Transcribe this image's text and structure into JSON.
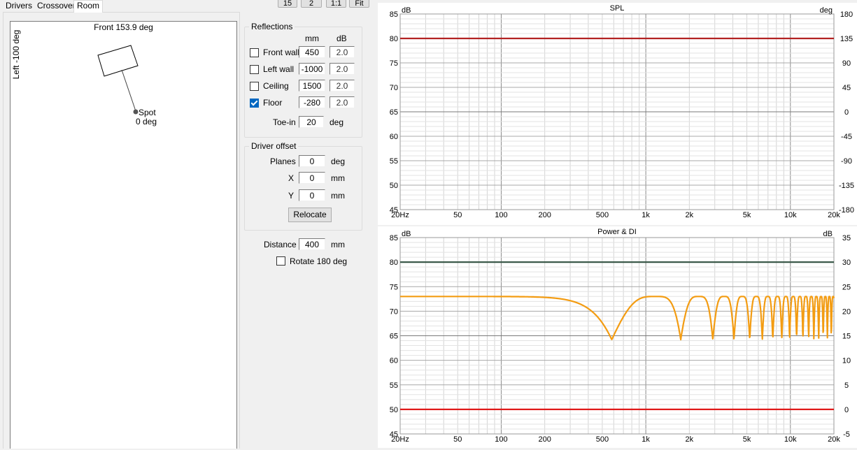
{
  "tabs": [
    "Drivers",
    "Crossover",
    "Room"
  ],
  "toolbar": [
    "15",
    "2",
    "1:1",
    "Fit"
  ],
  "room": {
    "front_label": "Front 153.9 deg",
    "left_label": "Left -100 deg",
    "spot_label": "Spot",
    "spot_deg": "0 deg"
  },
  "reflections": {
    "title": "Reflections",
    "col_mm": "mm",
    "col_db": "dB",
    "rows": [
      {
        "label": "Front wall",
        "checked": false,
        "mm": "450",
        "db": "2.0"
      },
      {
        "label": "Left wall",
        "checked": false,
        "mm": "-1000",
        "db": "2.0"
      },
      {
        "label": "Ceiling",
        "checked": false,
        "mm": "1500",
        "db": "2.0"
      },
      {
        "label": "Floor",
        "checked": true,
        "mm": "-280",
        "db": "2.0"
      }
    ],
    "toein_label": "Toe-in",
    "toein_value": "20",
    "toein_unit": "deg"
  },
  "offset": {
    "title": "Driver offset",
    "planes_label": "Planes",
    "planes_value": "0",
    "planes_unit": "deg",
    "x_label": "X",
    "x_value": "0",
    "x_unit": "mm",
    "y_label": "Y",
    "y_value": "0",
    "y_unit": "mm",
    "relocate": "Relocate"
  },
  "distance": {
    "label": "Distance",
    "value": "400",
    "unit": "mm"
  },
  "rotate": {
    "label": "Rotate 180 deg",
    "checked": false
  },
  "chart_data": [
    {
      "type": "line",
      "title": "SPL",
      "ylabel": "dB",
      "y2label": "deg",
      "xscale": "log",
      "xlim": [
        20,
        20000
      ],
      "ylim": [
        45,
        85
      ],
      "y2lim": [
        -180,
        180
      ],
      "yticks": [
        "85",
        "80",
        "75",
        "70",
        "65",
        "60",
        "55",
        "50",
        "45"
      ],
      "y2ticks": [
        "180",
        "135",
        "90",
        "45",
        "0",
        "-45",
        "-90",
        "-135",
        "-180"
      ],
      "xticks": [
        {
          "v": 20,
          "t": "20Hz"
        },
        {
          "v": 50,
          "t": "50"
        },
        {
          "v": 100,
          "t": "100"
        },
        {
          "v": 200,
          "t": "200"
        },
        {
          "v": 500,
          "t": "500"
        },
        {
          "v": 1000,
          "t": "1k"
        },
        {
          "v": 2000,
          "t": "2k"
        },
        {
          "v": 5000,
          "t": "5k"
        },
        {
          "v": 10000,
          "t": "10k"
        },
        {
          "v": 20000,
          "t": "20k"
        }
      ],
      "grid": true,
      "series": [
        {
          "color": "#b22222",
          "values": [
            [
              20,
              80
            ],
            [
              20000,
              80
            ]
          ]
        }
      ]
    },
    {
      "type": "line",
      "title": "Power & DI",
      "ylabel": "dB",
      "y2label": "dB",
      "xscale": "log",
      "xlim": [
        20,
        20000
      ],
      "ylim": [
        45,
        85
      ],
      "y2lim": [
        -5,
        35
      ],
      "yticks": [
        "85",
        "80",
        "75",
        "70",
        "65",
        "60",
        "55",
        "50",
        "45"
      ],
      "y2ticks": [
        "35",
        "30",
        "25",
        "20",
        "15",
        "10",
        "5",
        "0",
        "-5"
      ],
      "xticks": [
        {
          "v": 20,
          "t": "20Hz"
        },
        {
          "v": 50,
          "t": "50"
        },
        {
          "v": 100,
          "t": "100"
        },
        {
          "v": 200,
          "t": "200"
        },
        {
          "v": 500,
          "t": "500"
        },
        {
          "v": 1000,
          "t": "1k"
        },
        {
          "v": 2000,
          "t": "2k"
        },
        {
          "v": 5000,
          "t": "5k"
        },
        {
          "v": 10000,
          "t": "10k"
        },
        {
          "v": 20000,
          "t": "20k"
        }
      ],
      "grid": true,
      "series": [
        {
          "color": "#3c5a4a",
          "values": [
            [
              20,
              80
            ],
            [
              20000,
              80
            ]
          ]
        },
        {
          "color": "#e01a1a",
          "values": [
            [
              20,
              50
            ],
            [
              20000,
              50
            ]
          ]
        },
        {
          "color": "#f39c12",
          "comb": true,
          "level": 73,
          "notch_depth": 8.8,
          "delay_ms": 0.86
        }
      ]
    }
  ]
}
